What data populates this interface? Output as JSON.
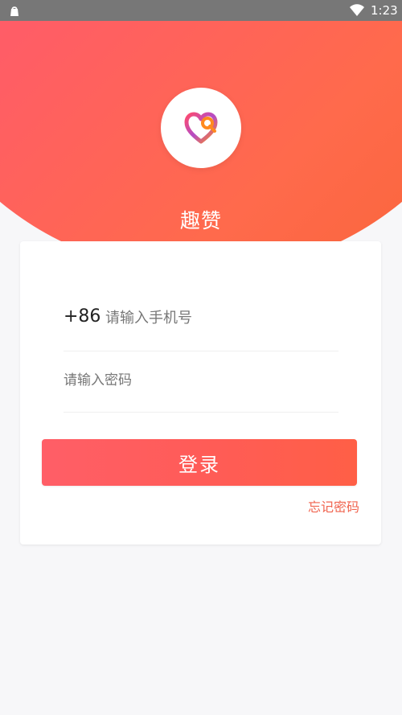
{
  "status_bar": {
    "time": "1:23",
    "left_icon": "bag-icon",
    "wifi_icon": "wifi-icon"
  },
  "hero": {
    "app_name": "趣赞",
    "logo_icon": "heart-logo-icon",
    "accent_start": "#ff5b79",
    "accent_end": "#f86436"
  },
  "login_form": {
    "country_code": "+86",
    "phone_placeholder": "请输入手机号",
    "password_placeholder": "请输入密码",
    "login_label": "登录",
    "forgot_label": "忘记密码"
  }
}
